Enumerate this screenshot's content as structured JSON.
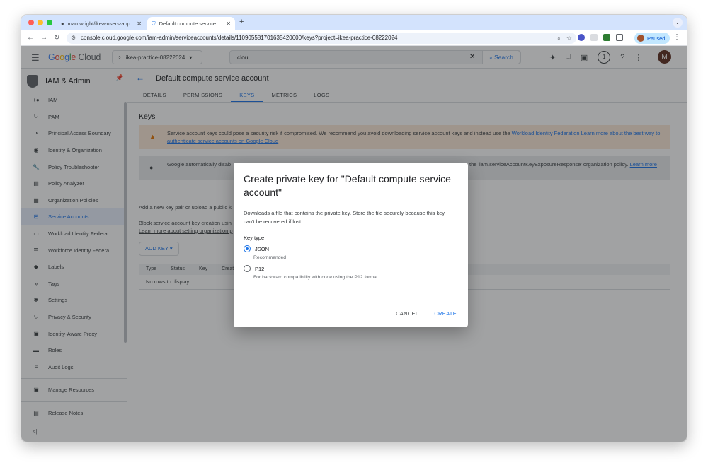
{
  "colors": {
    "accent": "#1a73e8",
    "tabbar": "#d3e3fd",
    "warn": "#e37400",
    "active_bg": "#e8f0fe"
  },
  "browser": {
    "tabs": [
      {
        "title": "marcwright/ikea-users-app",
        "icon": "github-icon"
      },
      {
        "title": "Default compute service accou",
        "icon": "shield-icon"
      }
    ],
    "new_tab": "+",
    "url": "console.cloud.google.com/iam-admin/serviceaccounts/details/110905581701635420600/keys?project=ikea-practice-08222024",
    "profile_label": "Paused"
  },
  "header": {
    "logo_google": "Google",
    "logo_cloud": "Cloud",
    "project": "ikea-practice-08222024",
    "search_value": "clou",
    "search_button": "Search",
    "notifications_count": "1",
    "avatar_letter": "M"
  },
  "sidebar": {
    "title": "IAM & Admin",
    "items": [
      {
        "label": "IAM",
        "icon": "person-add-icon"
      },
      {
        "label": "PAM",
        "icon": "shield-icon"
      },
      {
        "label": "Principal Access Boundary",
        "icon": "boundary-icon"
      },
      {
        "label": "Identity & Organization",
        "icon": "account-circle-icon"
      },
      {
        "label": "Policy Troubleshooter",
        "icon": "wrench-icon"
      },
      {
        "label": "Policy Analyzer",
        "icon": "document-search-icon"
      },
      {
        "label": "Organization Policies",
        "icon": "list-box-icon"
      },
      {
        "label": "Service Accounts",
        "icon": "service-account-icon",
        "active": true
      },
      {
        "label": "Workload Identity Federat...",
        "icon": "id-card-icon"
      },
      {
        "label": "Workforce Identity Federa...",
        "icon": "list-icon"
      },
      {
        "label": "Labels",
        "icon": "label-icon"
      },
      {
        "label": "Tags",
        "icon": "tag-icon"
      },
      {
        "label": "Settings",
        "icon": "gear-icon"
      },
      {
        "label": "Privacy & Security",
        "icon": "privacy-shield-icon"
      },
      {
        "label": "Identity-Aware Proxy",
        "icon": "proxy-icon"
      },
      {
        "label": "Roles",
        "icon": "roles-icon"
      },
      {
        "label": "Audit Logs",
        "icon": "audit-list-icon"
      }
    ],
    "footer_items": [
      {
        "label": "Manage Resources",
        "icon": "folder-icon"
      },
      {
        "label": "Release Notes",
        "icon": "notes-icon"
      }
    ],
    "collapse": "<|"
  },
  "main": {
    "title": "Default compute service account",
    "tabs": [
      "DETAILS",
      "PERMISSIONS",
      "KEYS",
      "METRICS",
      "LOGS"
    ],
    "active_tab": "KEYS",
    "section_title": "Keys",
    "alert1_text": "Service account keys could pose a security risk if compromised. We recommend you avoid downloading service account keys and instead use the ",
    "alert1_link": "Workload Identity Federation",
    "alert1_link2": "Learn more about the best way to authenticate service accounts on Google Cloud",
    "alert2_text": "Google automatically disab",
    "alert2_text_right": "the 'iam.serviceAccountKeyExposureResponse' organization policy.",
    "alert2_link": "Learn more",
    "add_text": "Add a new key pair or upload a public k",
    "block_text": "Block service account key creation usin",
    "block_link": "Learn more about setting organization p",
    "add_key_button": "ADD KEY",
    "table_headers": [
      "Type",
      "Status",
      "Key",
      "Creati"
    ],
    "empty_text": "No rows to display"
  },
  "dialog": {
    "title": "Create private key for \"Default compute service account\"",
    "description": "Downloads a file that contains the private key. Store the file securely because this key can't be recovered if lost.",
    "key_type_label": "Key type",
    "options": [
      {
        "label": "JSON",
        "sub": "Recommended",
        "selected": true
      },
      {
        "label": "P12",
        "sub": "For backward compatibility with code using the P12 format",
        "selected": false
      }
    ],
    "cancel": "CANCEL",
    "create": "CREATE"
  }
}
